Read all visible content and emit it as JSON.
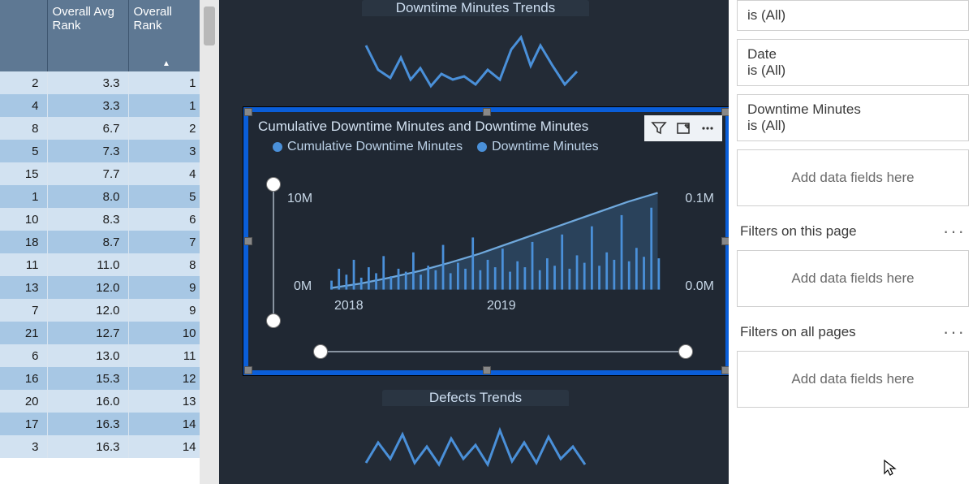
{
  "table": {
    "headers": [
      "",
      "Overall Avg Rank",
      "Overall Rank"
    ],
    "sort_indicator_col": 2,
    "rows": [
      [
        2,
        "3.3",
        1
      ],
      [
        4,
        "3.3",
        1
      ],
      [
        8,
        "6.7",
        2
      ],
      [
        5,
        "7.3",
        3
      ],
      [
        15,
        "7.7",
        4
      ],
      [
        1,
        "8.0",
        5
      ],
      [
        10,
        "8.3",
        6
      ],
      [
        18,
        "8.7",
        7
      ],
      [
        11,
        "11.0",
        8
      ],
      [
        13,
        "12.0",
        9
      ],
      [
        7,
        "12.0",
        9
      ],
      [
        21,
        "12.7",
        10
      ],
      [
        6,
        "13.0",
        11
      ],
      [
        16,
        "15.3",
        12
      ],
      [
        20,
        "16.0",
        13
      ],
      [
        17,
        "16.3",
        14
      ],
      [
        3,
        "16.3",
        14
      ]
    ]
  },
  "mini1": {
    "title": "Downtime Minutes Trends"
  },
  "mini2": {
    "title": "Defects Trends"
  },
  "visual": {
    "title": "Cumulative Downtime Minutes and Downtime Minutes",
    "legend1": "Cumulative Downtime Minutes",
    "legend2": "Downtime Minutes",
    "y_left_top": "10M",
    "y_left_bottom": "0M",
    "y_right_top": "0.1M",
    "y_right_bottom": "0.0M",
    "x_tick1": "2018",
    "x_tick2": "2019"
  },
  "chart_data": {
    "type": "line",
    "title": "Cumulative Downtime Minutes and Downtime Minutes",
    "xlabel": "",
    "ylabel_left": "Cumulative Downtime Minutes",
    "ylabel_right": "Downtime Minutes",
    "x_ticks": [
      "2018",
      "2019"
    ],
    "y_left_lim": [
      0,
      12000000
    ],
    "y_right_lim": [
      0,
      100000
    ],
    "series": [
      {
        "name": "Cumulative Downtime Minutes",
        "axis": "left",
        "x": [
          0,
          0.1,
          0.2,
          0.3,
          0.4,
          0.5,
          0.6,
          0.7,
          0.8,
          0.9,
          1.0
        ],
        "values": [
          0,
          800000,
          1600000,
          2600000,
          3600000,
          4800000,
          6200000,
          7600000,
          9000000,
          10200000,
          11800000
        ]
      },
      {
        "name": "Downtime Minutes",
        "axis": "right",
        "x": [
          0,
          0.05,
          0.1,
          0.15,
          0.2,
          0.25,
          0.3,
          0.35,
          0.4,
          0.45,
          0.5,
          0.55,
          0.6,
          0.65,
          0.7,
          0.75,
          0.8,
          0.85,
          0.9,
          0.95,
          1.0
        ],
        "values": [
          12000,
          30000,
          22000,
          48000,
          18000,
          35000,
          26000,
          55000,
          20000,
          32000,
          28000,
          60000,
          24000,
          38000,
          30000,
          72000,
          26000,
          44000,
          34000,
          88000,
          30000
        ]
      }
    ]
  },
  "filters": {
    "card0_sub": "is (All)",
    "card1_title": "Date",
    "card1_sub": "is (All)",
    "card2_title": "Downtime Minutes",
    "card2_sub": "is (All)",
    "drop_label": "Add data fields here",
    "section_page": "Filters on this page",
    "section_all": "Filters on all pages"
  }
}
